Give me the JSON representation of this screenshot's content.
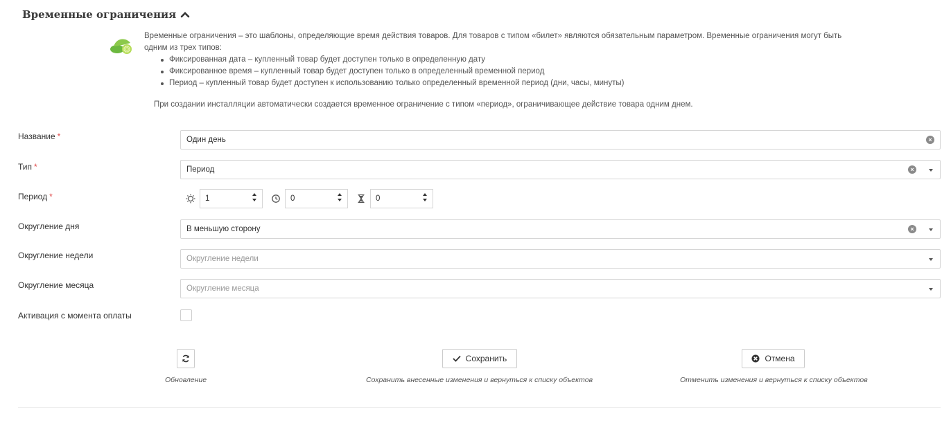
{
  "section": {
    "title": "Временные ограничения",
    "chevron_icon": "chevron-up-icon"
  },
  "info": {
    "icon": "lime-icon",
    "intro": "Временные ограничения – это шаблоны, определяющие время действия товаров. Для товаров с типом «билет» являются обязательным параметром. Временные ограничения могут быть одним из трех типов:",
    "items": [
      "Фиксированная дата – купленный товар будет доступен только в определенную дату",
      "Фиксированное время – купленный товар будет доступен только в определенный временной период",
      "Период – купленный товар будет доступен к использованию только определенный временной период (дни, часы, минуты)"
    ],
    "closing": "При создании инсталляции автоматически создается временное ограничение с типом «период», ограничивающее действие товара одним днем."
  },
  "form": {
    "name": {
      "label": "Название",
      "required_mark": "*",
      "value": "Один день"
    },
    "type": {
      "label": "Тип",
      "required_mark": "*",
      "value": "Период"
    },
    "period": {
      "label": "Период",
      "required_mark": "*",
      "days": "1",
      "hours": "0",
      "minutes": "0",
      "days_icon": "sun-icon",
      "hours_icon": "clock-icon",
      "minutes_icon": "hourglass-icon"
    },
    "day_rounding": {
      "label": "Округление дня",
      "value": "В меньшую сторону"
    },
    "week_rounding": {
      "label": "Округление недели",
      "placeholder": "Округление недели"
    },
    "month_rounding": {
      "label": "Округление месяца",
      "placeholder": "Округление месяца"
    },
    "activation": {
      "label": "Активация с момента оплаты",
      "checked": false
    }
  },
  "actions": {
    "refresh": {
      "icon": "refresh-icon",
      "caption": "Обновление"
    },
    "save": {
      "icon": "check-icon",
      "label": "Сохранить",
      "caption": "Сохранить внесенные изменения и вернуться к списку объектов"
    },
    "cancel": {
      "icon": "close-circle-icon",
      "label": "Отмена",
      "caption": "Отменить изменения и вернуться к списку объектов"
    }
  }
}
